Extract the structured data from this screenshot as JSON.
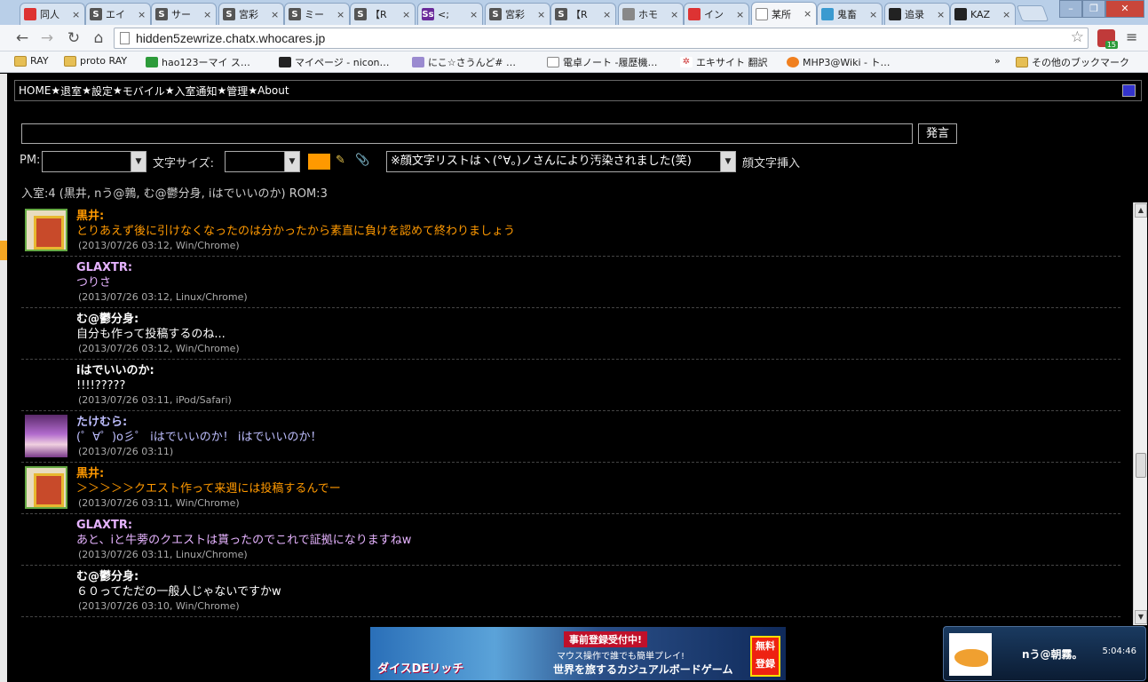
{
  "browser": {
    "tabs": [
      {
        "title": "同人",
        "fav_color": "#d33"
      },
      {
        "title": "エイ",
        "fav_color": "#555",
        "fav": "S"
      },
      {
        "title": "サー",
        "fav_color": "#555",
        "fav": "S"
      },
      {
        "title": "宮彩",
        "fav_color": "#555",
        "fav": "S"
      },
      {
        "title": "ミー",
        "fav_color": "#555",
        "fav": "S"
      },
      {
        "title": "【R",
        "fav_color": "#555",
        "fav": "S"
      },
      {
        "title": "<;",
        "fav_color": "#6a2a9a",
        "fav": "Ss"
      },
      {
        "title": "宮彩",
        "fav_color": "#555",
        "fav": "S"
      },
      {
        "title": "【R",
        "fav_color": "#555",
        "fav": "S"
      },
      {
        "title": "ホモ",
        "fav_color": "#888"
      },
      {
        "title": "イン",
        "fav_color": "#d33"
      },
      {
        "title": "某所",
        "fav_color": "#fff",
        "active": true
      },
      {
        "title": "鬼畜",
        "fav_color": "#3a9ad0"
      },
      {
        "title": "追录",
        "fav_color": "#222"
      },
      {
        "title": "KAZ",
        "fav_color": "#222"
      }
    ],
    "url": "hidden5zewrize.chatx.whocares.jp",
    "ext_badge": "15",
    "bookmarks": [
      "RAY",
      "proto RAY",
      "hao123ーマイ ス…",
      "マイページ - nicon…",
      "にこ☆さうんど# …",
      "電卓ノート -履歴機…",
      "エキサイト 翻訳",
      "MHP3@Wiki - ト…"
    ],
    "bookmarks_more": "»",
    "other_bookmarks": "その他のブックマーク"
  },
  "nav": {
    "links": [
      "HOME",
      "退室",
      "設定",
      "モバイル",
      "入室通知",
      "管理",
      "About"
    ],
    "separator": "★"
  },
  "form": {
    "message_value": "",
    "send_label": "発言",
    "pm_label": "PM:",
    "pm_value": "",
    "font_size_label": "文字サイズ:",
    "font_size_value": "",
    "kaomoji_value": "※顔文字リストはヽ(°∀。)ノさんにより汚染されました(笑)",
    "kaomoji_insert_label": "顔文字挿入",
    "color_value": "#ff9900"
  },
  "roster": "入室:4 (黒井, nう@鶉, む@鬱分身, iはでいいのか) ROM:3",
  "messages": [
    {
      "name": "黒井:",
      "text": "とりあえず後に引けなくなったのは分かったから素直に負けを認めて終わりましょう",
      "meta": "(2013/07/26 03:12, Win/Chrome)",
      "color": "#ff9900",
      "avatar": "kuroi"
    },
    {
      "name": "GLAXTR:",
      "text": "つりさ",
      "meta": "(2013/07/26 03:12, Linux/Chrome)",
      "color": "#e6b3ff",
      "avatar": ""
    },
    {
      "name": "む@鬱分身:",
      "text": "自分も作って投稿するのね...",
      "meta": "(2013/07/26 03:12, Win/Chrome)",
      "color": "#ffffff",
      "avatar": ""
    },
    {
      "name": "iはでいいのか:",
      "text": "!!!!?????",
      "meta": "(2013/07/26 03:11, iPod/Safari)",
      "color": "#ffffff",
      "avatar": ""
    },
    {
      "name": "たけむら:",
      "text": "(゜∀゜)o彡゜ iはでいいのか！ iはでいいのか！",
      "meta": "(2013/07/26 03:11)",
      "color": "#bfbfff",
      "avatar": "takemura"
    },
    {
      "name": "黒井:",
      "text": "＞＞＞＞＞クエスト作って来週には投稿するんでー",
      "meta": "(2013/07/26 03:11, Win/Chrome)",
      "color": "#ff9900",
      "avatar": "kuroi"
    },
    {
      "name": "GLAXTR:",
      "text": "あと、iと牛蒡のクエストは貰ったのでこれで証拠になりますねw",
      "meta": "(2013/07/26 03:11, Linux/Chrome)",
      "color": "#e6b3ff",
      "avatar": ""
    },
    {
      "name": "む@鬱分身:",
      "text": "６０ってただの一般人じゃないですかw",
      "meta": "(2013/07/26 03:10, Win/Chrome)",
      "color": "#ffffff",
      "avatar": ""
    }
  ],
  "ad": {
    "logo": "ダイスDEリッチ",
    "headline": "事前登録受付中!",
    "line1": "マウス操作で誰でも簡単プレイ!",
    "line2": "世界を旅するカジュアルボードゲーム",
    "badge": "無料登録"
  },
  "notification": {
    "name": "nう@朝霧。",
    "time": "5:04:46"
  }
}
